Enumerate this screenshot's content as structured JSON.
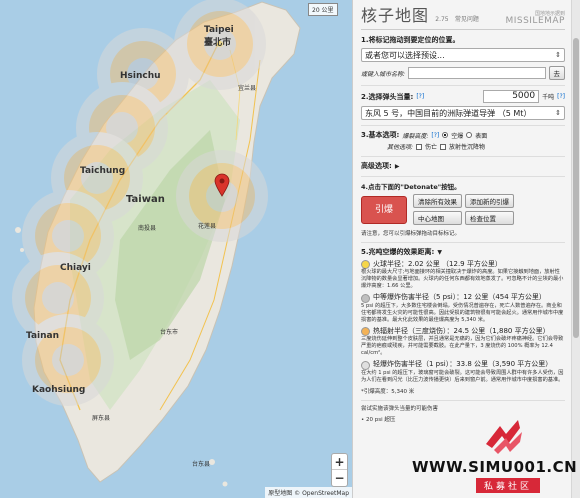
{
  "map": {
    "scale_label": "20 公里",
    "zoom_in": "+",
    "zoom_out": "−",
    "attribution": "原型地图 © OpenStreetMap",
    "city_labels": [
      {
        "name": "Taipei"
      },
      {
        "name": "臺北市"
      },
      {
        "name": "Hsinchu"
      },
      {
        "name": "Taichung"
      },
      {
        "name": "Taiwan"
      },
      {
        "name": "Chiayi"
      },
      {
        "name": "Tainan"
      },
      {
        "name": "Kaohsiung"
      },
      {
        "name": "台东市"
      },
      {
        "name": "花莲县"
      },
      {
        "name": "宜兰县"
      },
      {
        "name": "南投县"
      },
      {
        "name": "屏东县"
      },
      {
        "name": "台东县"
      }
    ]
  },
  "panel": {
    "title": "核子地图",
    "version": "2.75",
    "faq": "常见问题",
    "brand_small": "国地地示据到",
    "brand_big": "MISSILEMAP",
    "step1": "1.将标记拖动到要定位的位置。",
    "preset_placeholder": "或者您可以选择预设...",
    "city_label": "或键入城市名称:",
    "go": "去",
    "step2": "2.选择弹头当量:",
    "help_q": "[?]",
    "yield_value": "5000",
    "yield_unit": "千吨",
    "warhead": "东风 5 号，中国目前的洲际弹道导弹 （5 Mt）",
    "step3": "3.基本选项:",
    "burst_height": "爆裂高度:",
    "airburst": "空爆",
    "surface": "表面",
    "other_opts": "其他选项:",
    "casualties": "伤亡",
    "fallout": "放射性沉降物",
    "advanced": "高级选项:",
    "advanced_arrow": "▶",
    "step4": "4.点击下面的\"Detonate\"按钮。",
    "detonate": "引爆",
    "clear_all": "清除所有效果",
    "add_new": "添加新的引爆",
    "center_map": "中心地图",
    "check_pos": "检查位置",
    "note": "请注意，您可以引爆标弹拖动目标标记。",
    "step5": "5.兆吨空爆的效果距离:",
    "step5_arrow": "▼",
    "effects": [
      {
        "head": "火球半径：2.02 公里 （12.9 平方公里）",
        "body": "根火球的最大尺寸;与地面接环的相关撞取决于爆炸的高度。如果它接触到地面，放射性沉降物的数量会显著增加。火球内的任何东西都有效地蒸发了。可忽略不计的尘埃的最小爆炸高度：1.66 公里。"
      },
      {
        "head": "中等爆炸伤害半径（5 psi）：12 公里（454 平方公里）",
        "body": "5 psi 的超压下，大多数住宅楼会倒塌，受伤情况普遍存在，死亡人数普遍存在。商业和住宅都将发生火灾的可能性很高。因此受损的建筑物很有可能会起火。通常用作城市中度损害的基准。最大化此效果的最佳爆高度为 5,340 米。"
      },
      {
        "head": "热辐射半径（三度烧伤）：24.5 公里（1,880 平方公里）",
        "body": "三度烧伤延伸到整个皮肤层，并且通常是无痛的，因为它们会破坏疼痛神经。它们会导致严重的疤痕或残疾，并可能需要截肢。在此产量下，3 度烧伤的 100% 概率为 12.4 cal/cm²。"
      },
      {
        "head": "轻爆炸伤害半径（1 psi）：33.8 公里（3,590 平方公里）",
        "body": "在大约 1 psi 的超压下，玻璃窗可能会破裂。这可能会导致周围人群中有许多人受伤，因为人们在看到闪光（比压力波传播更快）后来到窗户前。通常用作城市中度损害的基准。"
      }
    ],
    "fine_note": "*引爆高度：5,340 米",
    "footer": "尝试实施该弹头当量的可能伤害",
    "footer_item": "• 20 psi 超压"
  },
  "watermark": {
    "site": "WWW.SIMU001.CN",
    "sub": "私募社区"
  }
}
